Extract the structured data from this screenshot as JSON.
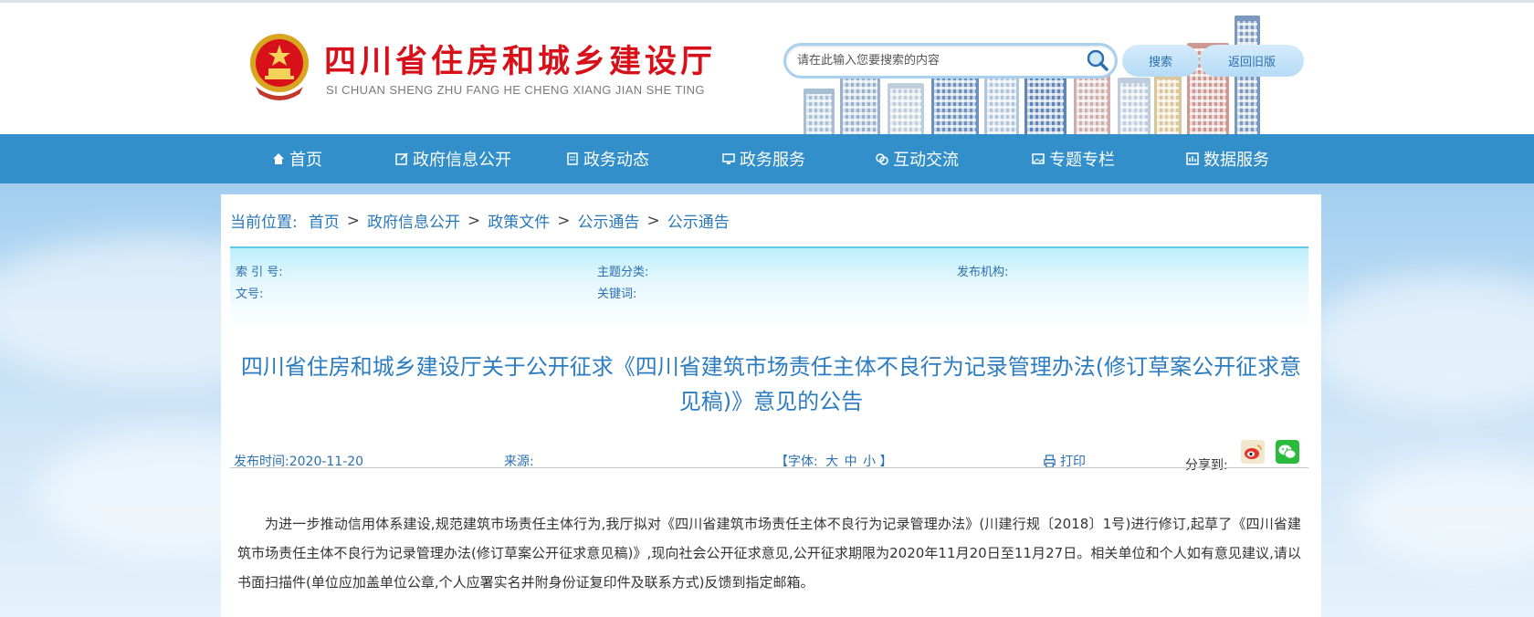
{
  "site": {
    "title_cn": "四川省住房和城乡建设厅",
    "title_en": "SI CHUAN SHENG ZHU FANG HE CHENG XIANG JIAN SHE TING"
  },
  "search": {
    "placeholder": "请在此输入您要搜索的内容",
    "search_button": "搜索",
    "old_version_button": "返回旧版"
  },
  "nav": {
    "items": [
      {
        "label": "首页",
        "icon": "home-icon"
      },
      {
        "label": "政府信息公开",
        "icon": "edit-icon"
      },
      {
        "label": "政务动态",
        "icon": "document-icon"
      },
      {
        "label": "政务服务",
        "icon": "monitor-icon"
      },
      {
        "label": "互动交流",
        "icon": "chat-icon"
      },
      {
        "label": "专题专栏",
        "icon": "image-icon"
      },
      {
        "label": "数据服务",
        "icon": "chart-icon"
      }
    ]
  },
  "breadcrumb": {
    "prefix": "当前位置:",
    "items": [
      "首页",
      "政府信息公开",
      "政策文件",
      "公示通告",
      "公示通告"
    ]
  },
  "meta": {
    "index_no": "索 引 号:",
    "topic": "主题分类:",
    "publisher": "发布机构:",
    "doc_no": "文号:",
    "keywords": "关键词:"
  },
  "article": {
    "title": "四川省住房和城乡建设厅关于公开征求《四川省建筑市场责任主体不良行为记录管理办法(修订草案公开征求意见稿)》意见的公告",
    "publish_time": "发布时间:2020-11-20",
    "source": "来源:",
    "font_label": "【字体:",
    "font_large": "大",
    "font_medium": "中",
    "font_small": "小",
    "font_close": "】",
    "print_label": "打印",
    "share_label": "分享到:",
    "body": "为进一步推动信用体系建设,规范建筑市场责任主体行为,我厅拟对《四川省建筑市场责任主体不良行为记录管理办法》(川建行规〔2018〕1号)进行修订,起草了《四川省建筑市场责任主体不良行为记录管理办法(修订草案公开征求意见稿)》,现向社会公开征求意见,公开征求期限为2020年11月20日至11月27日。相关单位和个人如有意见建议,请以书面扫描件(单位应加盖单位公章,个人应署实名并附身份证复印件及联系方式)反馈到指定邮箱。"
  },
  "colors": {
    "brand_red": "#d7101a",
    "nav_blue": "#2386c4",
    "link_blue": "#2878b8",
    "weibo_orange": "#e6a23c",
    "wechat_green": "#2bbb3c"
  }
}
